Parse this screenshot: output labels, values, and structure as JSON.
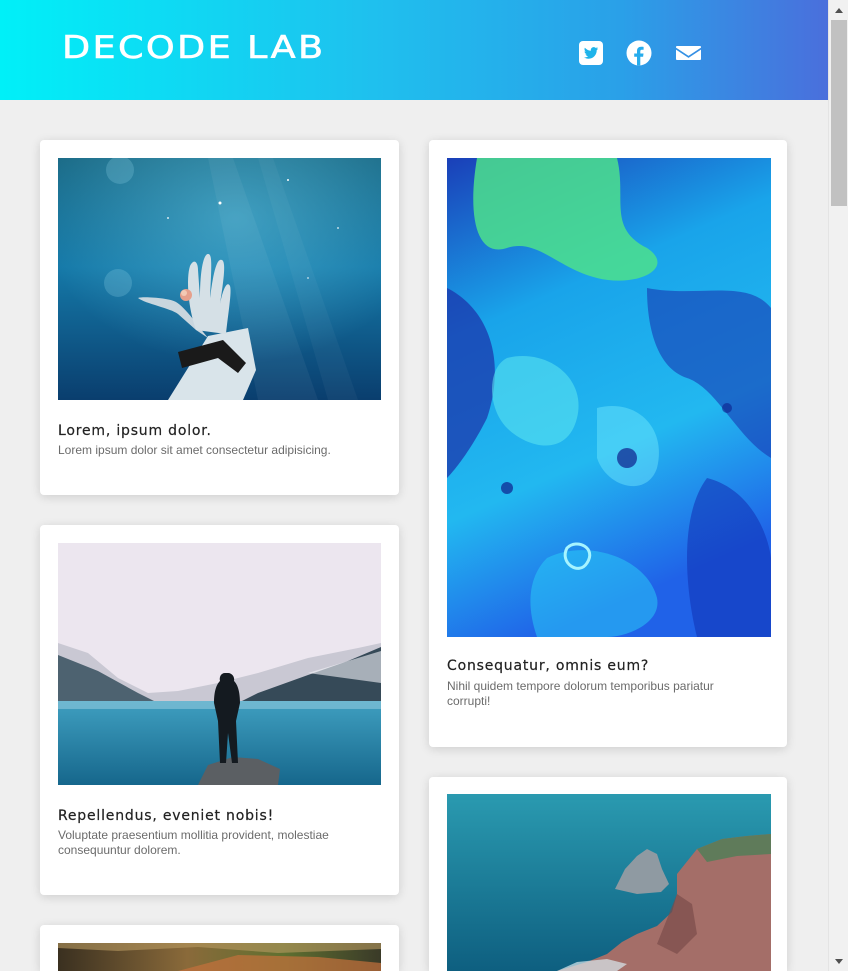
{
  "header": {
    "logo": "DECODE LAB",
    "social": [
      {
        "name": "twitter",
        "icon": "twitter-icon"
      },
      {
        "name": "facebook",
        "icon": "facebook-icon"
      },
      {
        "name": "email",
        "icon": "envelope-icon"
      }
    ]
  },
  "cards": [
    {
      "image": "underwater-hand-photo",
      "title": "Lorem, ipsum dolor.",
      "text": "Lorem ipsum dolor sit amet consectetur adipisicing."
    },
    {
      "image": "blue-marble-abstract-photo",
      "title": "Consequatur, omnis eum?",
      "text": "Nihil quidem tempore dolorum temporibus pariatur corrupti!"
    },
    {
      "image": "lake-mountains-person-photo",
      "title": "Repellendus, eveniet nobis!",
      "text": "Voluptate praesentium mollitia provident, molestiae consequuntur dolorem."
    },
    {
      "image": "sea-cliffs-photo",
      "title": "",
      "text": ""
    },
    {
      "image": "mountain-landscape-photo",
      "title": "",
      "text": ""
    }
  ],
  "colors": {
    "header_gradient": [
      "#00f0f8",
      "#2aa0e8",
      "#4a6fdc"
    ],
    "page_background": "#efefef",
    "card_background": "#ffffff"
  }
}
